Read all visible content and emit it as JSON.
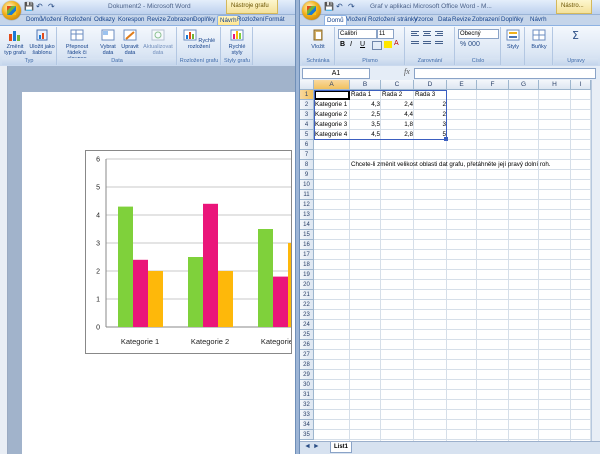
{
  "word": {
    "window_title": "Dokument2 - Microsoft Word",
    "context_tab_group": "Nástroje grafu",
    "tabs": [
      "Domů",
      "Vložení",
      "Rozložení",
      "Odkazy",
      "Korespon",
      "Revize",
      "Zobrazení",
      "Doplňky",
      "Návrh",
      "Rozložení",
      "Formát"
    ],
    "active_tab_index": 8,
    "groups": {
      "type": {
        "label": "Typ",
        "buttons": [
          "Změnit typ grafu",
          "Uložit jako šablonu"
        ]
      },
      "data": {
        "label": "Data",
        "buttons": [
          "Přepnout řádek či sloupec",
          "Vybrat data",
          "Upravit data",
          "Aktualizovat data"
        ]
      },
      "layout": {
        "label": "Rozložení grafu",
        "buttons": [
          "Rychlé rozložení"
        ]
      },
      "styles": {
        "label": "Styly grafu",
        "buttons": [
          "Rychlé styly"
        ]
      }
    }
  },
  "chart_data": {
    "type": "bar",
    "categories": [
      "Kategorie 1",
      "Kategorie 2",
      "Kategorie 3"
    ],
    "series": [
      {
        "name": "Řada 1",
        "color": "#7fd13b",
        "values": [
          4.3,
          2.5,
          3.5
        ]
      },
      {
        "name": "Řada 2",
        "color": "#ea157a",
        "values": [
          2.4,
          4.4,
          1.8
        ]
      },
      {
        "name": "Řada 3",
        "color": "#feb80a",
        "values": [
          2,
          2,
          3
        ]
      }
    ],
    "ylim": [
      0,
      6
    ],
    "yticks": [
      "0",
      "1",
      "2",
      "3",
      "4",
      "5",
      "6"
    ],
    "grid": true
  },
  "excel": {
    "window_title": "Graf v aplikaci Microsoft Office Word - M...",
    "context_tab_group": "Nástro...",
    "tabs": [
      "Domů",
      "Vložení",
      "Rozložení stránky",
      "Vzorce",
      "Data",
      "Revize",
      "Zobrazení",
      "Doplňky",
      "Návrh"
    ],
    "active_tab_index": 0,
    "clipboard": {
      "label": "Schránka",
      "paste": "Vložit"
    },
    "font": {
      "label": "Písmo",
      "name": "Calibri",
      "size": "11",
      "bold": "B",
      "italic": "I",
      "underline": "U"
    },
    "alignment": {
      "label": "Zarovnání"
    },
    "number": {
      "label": "Číslo",
      "format": "Obecný"
    },
    "styles_label": "Styly",
    "cells_label": "Buňky",
    "editing_label": "Úpravy",
    "name_box": "A1",
    "fx": "fx",
    "columns": [
      "A",
      "B",
      "C",
      "D",
      "E",
      "F",
      "G",
      "H",
      "I"
    ],
    "rows": [
      "1",
      "2",
      "3",
      "4",
      "5",
      "6",
      "7",
      "8",
      "9",
      "10",
      "11",
      "12",
      "13",
      "14",
      "15",
      "16",
      "17",
      "18",
      "19",
      "20",
      "21",
      "22",
      "23",
      "24",
      "25",
      "26",
      "27",
      "28",
      "29",
      "30",
      "31",
      "32",
      "33",
      "34",
      "35"
    ],
    "table": {
      "headers": [
        "",
        "Řada 1",
        "Řada 2",
        "Řada 3"
      ],
      "rows": [
        [
          "Kategorie 1",
          "4,3",
          "2,4",
          "2"
        ],
        [
          "Kategorie 2",
          "2,5",
          "4,4",
          "2"
        ],
        [
          "Kategorie 3",
          "3,5",
          "1,8",
          "3"
        ],
        [
          "Kategorie 4",
          "4,5",
          "2,8",
          "5"
        ]
      ]
    },
    "resize_hint": "Chcete-li změnit velikost oblasti dat grafu, přetáhněte její pravý dolní roh.",
    "sheet_tab": "List1"
  }
}
